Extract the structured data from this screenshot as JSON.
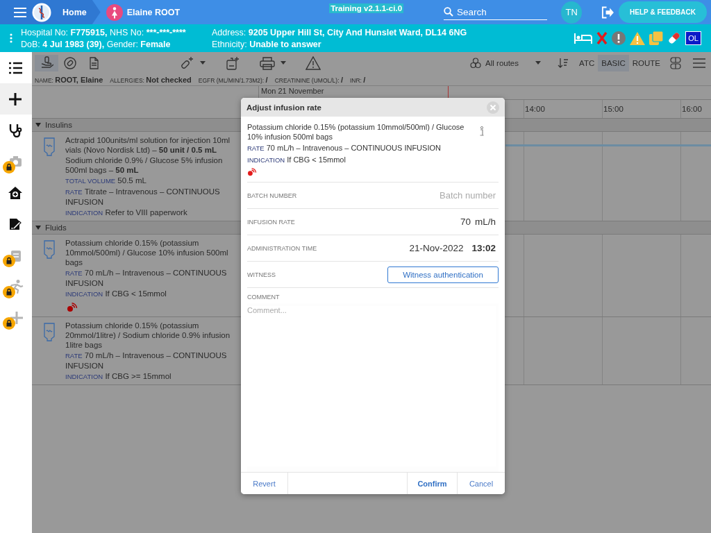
{
  "topbar": {
    "home": "Home",
    "patient_name": "Elaine ROOT",
    "environment": "Training v2.1.1-ci.0",
    "search_placeholder": "Search",
    "user_initials": "TN",
    "help_button": "HELP & FEEDBACK"
  },
  "patient_banner": {
    "left_lines": [
      [
        {
          "label": "Hospital No:",
          "value": "F775915,"
        },
        {
          "label": "NHS No:",
          "value": "***-***-****"
        }
      ],
      [
        {
          "label": "DoB:",
          "value": "4 Jul 1983 (39),"
        },
        {
          "label": "Gender:",
          "value": "Female"
        }
      ]
    ],
    "right_lines": [
      [
        {
          "label": "Address:",
          "value": "9205 Upper Hill St, City And Hunslet Ward, DL14 6NG"
        }
      ],
      [
        {
          "label": "Ethnicity:",
          "value": "Unable to answer"
        }
      ]
    ],
    "badge": "OL"
  },
  "sidebar": {
    "items": [
      {
        "selected": false,
        "locked": false
      },
      {
        "selected": true,
        "locked": false
      },
      {
        "selected": false,
        "locked": false
      },
      {
        "selected": false,
        "locked": true
      },
      {
        "selected": false,
        "locked": false
      },
      {
        "selected": false,
        "locked": false
      },
      {
        "selected": false,
        "locked": true
      },
      {
        "selected": false,
        "locked": true
      },
      {
        "selected": false,
        "locked": true
      }
    ]
  },
  "toolbar": {
    "view_buttons": [
      {
        "selected": true
      },
      {
        "selected": false
      },
      {
        "selected": false
      }
    ],
    "route_filter": "All routes",
    "modes": [
      {
        "label": "ATC",
        "selected": false
      },
      {
        "label": "BASIC",
        "selected": true
      },
      {
        "label": "ROUTE",
        "selected": false
      }
    ]
  },
  "patient_info": [
    {
      "label": "NAME:",
      "value": "ROOT, Elaine"
    },
    {
      "label": "ALLERGIES:",
      "value": "Not checked"
    },
    {
      "label": "EGFR (ML/MIN/1.73M2):",
      "value": "/"
    },
    {
      "label": "CREATININE (UMOL/L):",
      "value": "/"
    },
    {
      "label": "INR:",
      "value": "/"
    }
  ],
  "timeline": {
    "date": "Mon 21 November",
    "hours": [
      "14:00",
      "15:00",
      "16:00"
    ]
  },
  "groups": [
    {
      "name": "Insulins",
      "expanded": true,
      "items": [
        {
          "alert": false,
          "infusion_running": true,
          "lines": [
            {
              "text": "Actrapid 100units/ml solution for injection 10ml vials (Novo Nordisk Ltd) – **50 unit / 0.5 mL**"
            },
            {
              "text": "Sodium chloride 0.9% / Glucose 5% infusion 500ml bags – **50 mL**"
            },
            {
              "label": "TOTAL VOLUME",
              "text": "50.5 mL"
            },
            {
              "label": "RATE",
              "text": "Titrate – Intravenous – CONTINUOUS INFUSION"
            },
            {
              "label": "INDICATION",
              "text": "Refer to VIII paperwork"
            }
          ]
        }
      ]
    },
    {
      "name": "Fluids",
      "expanded": true,
      "items": [
        {
          "alert": true,
          "infusion_running": false,
          "lines": [
            {
              "text": "Potassium chloride 0.15% (potassium 10mmol/500ml) / Glucose 10% infusion 500ml bags"
            },
            {
              "label": "RATE",
              "text": "70 mL/h – Intravenous – CONTINUOUS INFUSION"
            },
            {
              "label": "INDICATION",
              "text": "If CBG < 15mmol"
            }
          ]
        },
        {
          "alert": false,
          "infusion_running": false,
          "lines": [
            {
              "text": "Potassium chloride 0.15% (potassium 20mmol/1litre) / Sodium chloride 0.9% infusion 1litre bags"
            },
            {
              "label": "RATE",
              "text": "70 mL/h – Intravenous – CONTINUOUS INFUSION"
            },
            {
              "label": "INDICATION",
              "text": "If CBG >= 15mmol"
            }
          ]
        }
      ]
    }
  ],
  "dialog": {
    "title": "Adjust infusion rate",
    "product": "Potassium chloride 0.15% (potassium 10mmol/500ml) / Glucose 10% infusion 500ml bags",
    "details": [
      {
        "label": "RATE",
        "text": "70 mL/h – Intravenous – CONTINUOUS INFUSION"
      },
      {
        "label": "INDICATION",
        "text": "If CBG < 15mmol"
      }
    ],
    "alert": true,
    "fields": [
      {
        "kind": "input",
        "label": "BATCH NUMBER",
        "placeholder": "Batch number"
      },
      {
        "kind": "value",
        "label": "INFUSION RATE",
        "value": "70",
        "unit": "mL/h"
      },
      {
        "kind": "datetime",
        "label": "ADMINISTRATION TIME",
        "date": "21-Nov-2022",
        "time": "13:02"
      },
      {
        "kind": "button",
        "label": "WITNESS",
        "button": "Witness authentication"
      }
    ],
    "comment": {
      "label": "COMMENT",
      "placeholder": "Comment..."
    },
    "actions": [
      {
        "label": "Revert",
        "primary": false
      },
      {
        "label": "Confirm",
        "primary": true
      },
      {
        "label": "Cancel",
        "primary": false
      }
    ]
  }
}
